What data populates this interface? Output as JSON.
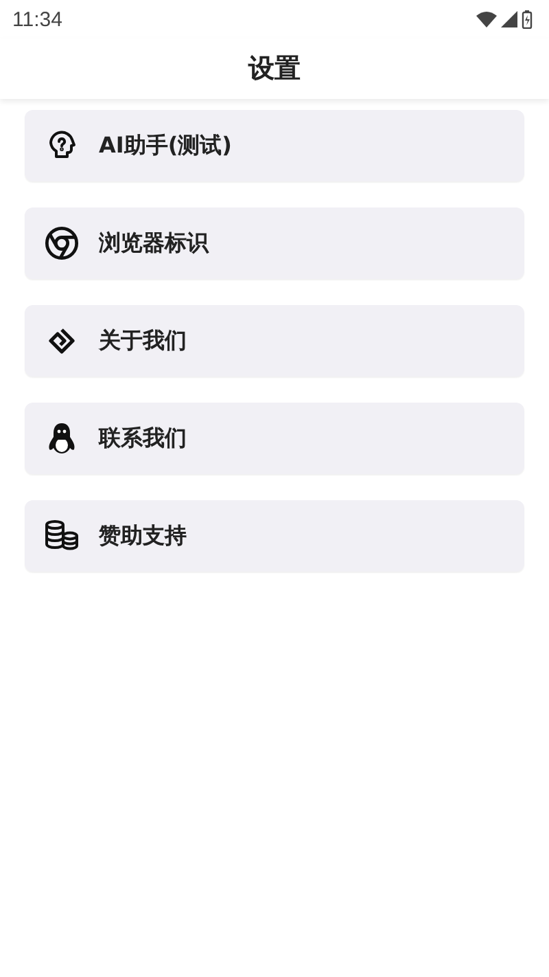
{
  "status_bar": {
    "time": "11:34"
  },
  "app_bar": {
    "title": "设置"
  },
  "items": [
    {
      "kind": "head",
      "label": "AI助手(测试)"
    },
    {
      "kind": "browser",
      "label": "浏览器标识"
    },
    {
      "kind": "diamond",
      "label": "关于我们"
    },
    {
      "kind": "penguin",
      "label": "联系我们"
    },
    {
      "kind": "coins",
      "label": "赞助支持"
    }
  ]
}
